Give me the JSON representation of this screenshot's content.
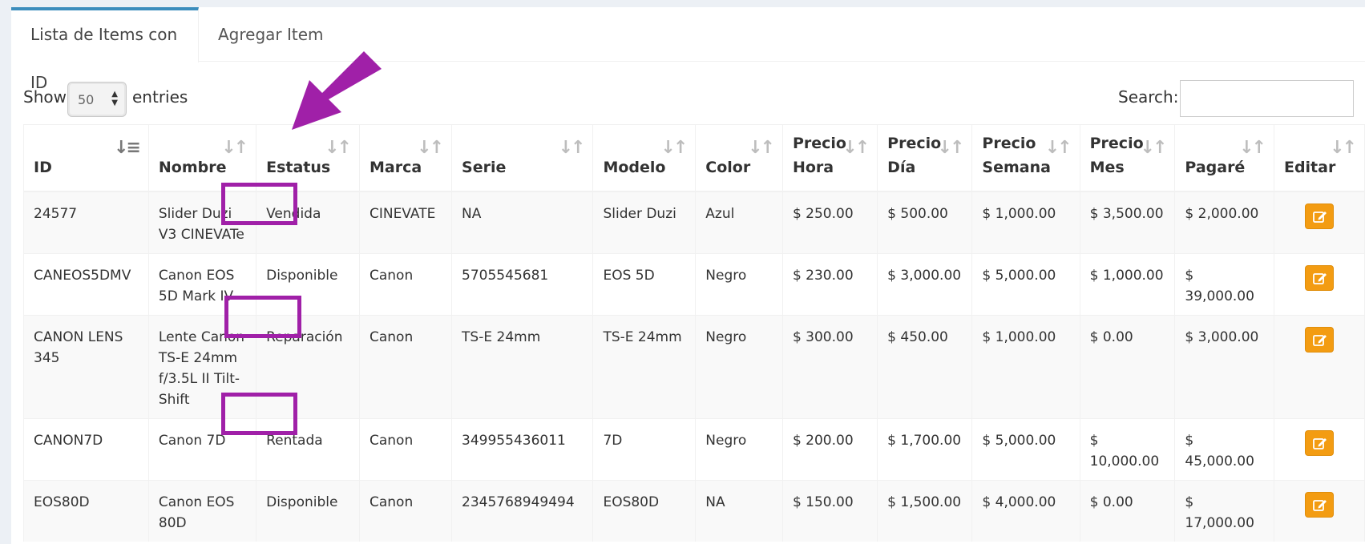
{
  "tabs": {
    "active": "Lista de Items con ID",
    "second": "Agregar Item"
  },
  "controls": {
    "show": "Show",
    "entries": "entries",
    "page_size": "50",
    "search_label": "Search:",
    "search_value": ""
  },
  "columns": [
    {
      "line1": "ID",
      "line2": ""
    },
    {
      "line1": "Nombre",
      "line2": ""
    },
    {
      "line1": "Estatus",
      "line2": ""
    },
    {
      "line1": "Marca",
      "line2": ""
    },
    {
      "line1": "Serie",
      "line2": ""
    },
    {
      "line1": "Modelo",
      "line2": ""
    },
    {
      "line1": "Color",
      "line2": ""
    },
    {
      "line1": "Precio",
      "line2": "Hora"
    },
    {
      "line1": "Precio",
      "line2": "Día"
    },
    {
      "line1": "Precio",
      "line2": "Semana"
    },
    {
      "line1": "Precio",
      "line2": "Mes"
    },
    {
      "line1": "Pagaré",
      "line2": ""
    },
    {
      "line1": "Editar",
      "line2": ""
    }
  ],
  "rows": [
    {
      "id": "24577",
      "nombre": "Slider Duzi V3 CINEVATe",
      "estatus": "Vendida",
      "marca": "CINEVATE",
      "serie": "NA",
      "modelo": "Slider Duzi",
      "color": "Azul",
      "hora": "$ 250.00",
      "dia": "$ 500.00",
      "semana": "$ 1,000.00",
      "mes": "$ 3,500.00",
      "pagare": "$ 2,000.00"
    },
    {
      "id": "CANEOS5DMV",
      "nombre": "Canon EOS 5D Mark IV",
      "estatus": "Disponible",
      "marca": "Canon",
      "serie": "5705545681",
      "modelo": "EOS 5D",
      "color": "Negro",
      "hora": "$ 230.00",
      "dia": "$ 3,000.00",
      "semana": "$ 5,000.00",
      "mes": "$ 1,000.00",
      "pagare": "$ 39,000.00"
    },
    {
      "id": "CANON LENS 345",
      "nombre": "Lente Canon TS-E 24mm f/3.5L II Tilt-Shift",
      "estatus": "Reparación",
      "marca": "Canon",
      "serie": "TS-E 24mm",
      "modelo": "TS-E 24mm",
      "color": "Negro",
      "hora": "$ 300.00",
      "dia": "$ 450.00",
      "semana": "$ 1,000.00",
      "mes": "$ 0.00",
      "pagare": "$ 3,000.00"
    },
    {
      "id": "CANON7D",
      "nombre": "Canon 7D",
      "estatus": "Rentada",
      "marca": "Canon",
      "serie": "349955436011",
      "modelo": "7D",
      "color": "Negro",
      "hora": "$ 200.00",
      "dia": "$ 1,700.00",
      "semana": "$ 5,000.00",
      "mes": "$ 10,000.00",
      "pagare": "$ 45,000.00"
    },
    {
      "id": "EOS80D",
      "nombre": "Canon EOS 80D",
      "estatus": "Disponible",
      "marca": "Canon",
      "serie": "2345768949494",
      "modelo": "EOS80D",
      "color": "NA",
      "hora": "$ 150.00",
      "dia": "$ 1,500.00",
      "semana": "$ 4,000.00",
      "mes": "$ 0.00",
      "pagare": "$ 17,000.00"
    }
  ],
  "colors": {
    "tab_accent": "#3c8dbc",
    "edit_button": "#f39c12",
    "highlight": "#a020a8"
  },
  "icons": {
    "edit": "edit-icon",
    "sort": "sort-icon",
    "arrow": "annotation-arrow"
  }
}
